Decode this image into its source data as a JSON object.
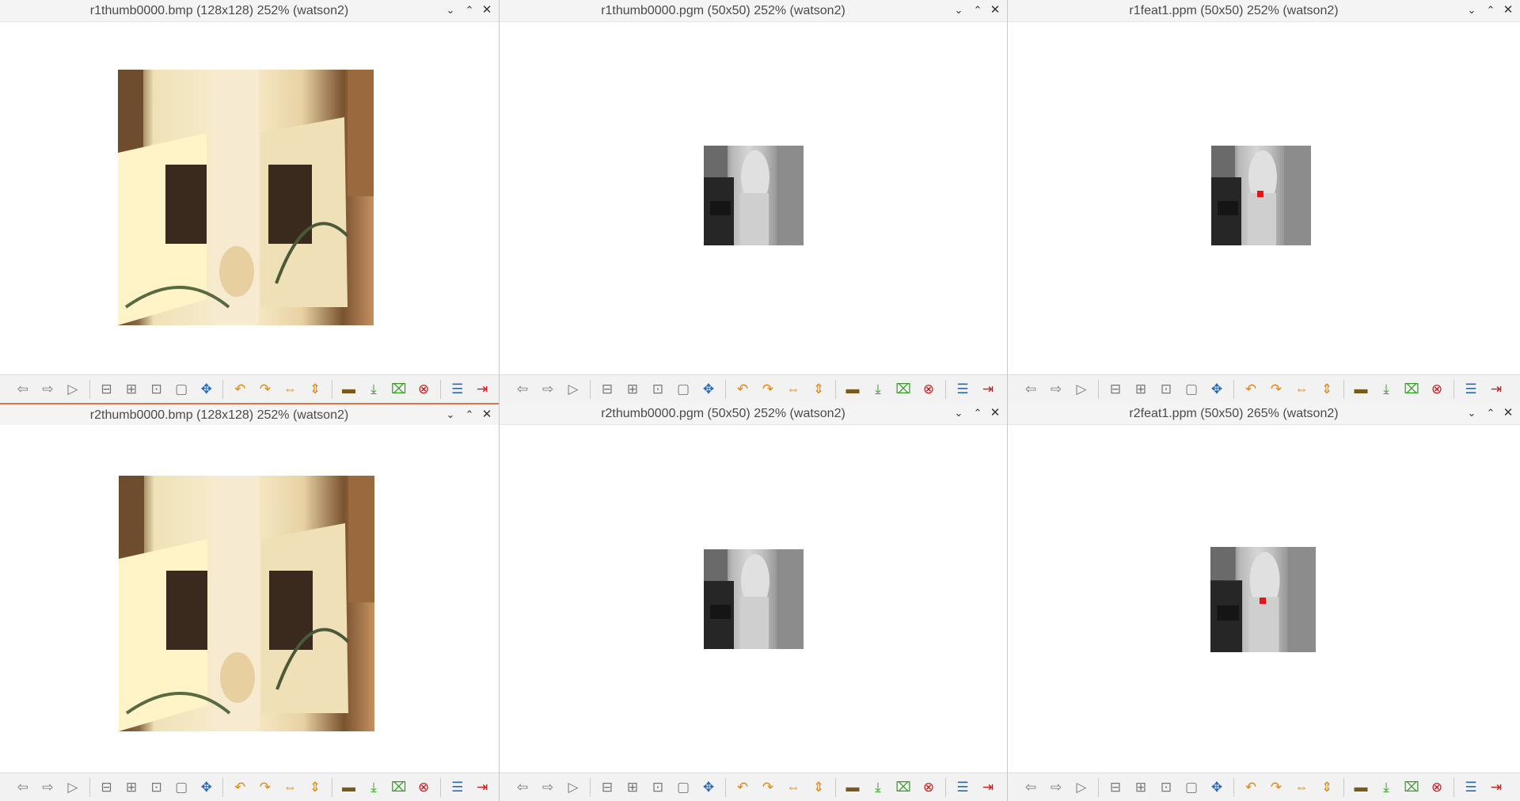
{
  "windows": [
    {
      "title": "r1thumb0000.bmp (128x128) 252% (watson2)",
      "image_kind": "color-thumbnail",
      "has_feature_marker": false
    },
    {
      "title": "r1thumb0000.pgm (50x50) 252% (watson2)",
      "image_kind": "gray-thumbnail",
      "has_feature_marker": false
    },
    {
      "title": "r1feat1.ppm (50x50) 252% (watson2)",
      "image_kind": "gray-thumbnail",
      "has_feature_marker": true,
      "marker_color": "#ee1111"
    },
    {
      "title": "r2thumb0000.bmp (128x128) 252% (watson2)",
      "image_kind": "color-thumbnail",
      "has_feature_marker": false
    },
    {
      "title": "r2thumb0000.pgm (50x50) 252% (watson2)",
      "image_kind": "gray-thumbnail",
      "has_feature_marker": false
    },
    {
      "title": "r2feat1.ppm (50x50) 265% (watson2)",
      "image_kind": "gray-thumbnail",
      "has_feature_marker": true,
      "marker_color": "#ee1111"
    }
  ],
  "titlebar_controls": {
    "minimize_glyph": "⌄",
    "maximize_glyph": "⌃",
    "close_glyph": "✕"
  },
  "toolbar": {
    "buttons": [
      {
        "icon": "prev-image-icon",
        "glyph": "⇦",
        "tint": "gray"
      },
      {
        "icon": "next-image-icon",
        "glyph": "⇨",
        "tint": "gray"
      },
      {
        "icon": "play-slideshow-icon",
        "glyph": "▷",
        "tint": "gray"
      },
      {
        "icon": "zoom-out-icon",
        "glyph": "⊟",
        "tint": "gray"
      },
      {
        "icon": "zoom-in-icon",
        "glyph": "⊞",
        "tint": "gray"
      },
      {
        "icon": "zoom-fit-icon",
        "glyph": "⊡",
        "tint": "gray"
      },
      {
        "icon": "zoom-original-icon",
        "glyph": "▢",
        "tint": "gray"
      },
      {
        "icon": "fullscreen-icon",
        "glyph": "✥",
        "tint": "blue"
      },
      {
        "icon": "rotate-left-icon",
        "glyph": "↶",
        "tint": "orange"
      },
      {
        "icon": "rotate-right-icon",
        "glyph": "↷",
        "tint": "orange"
      },
      {
        "icon": "flip-horizontal-icon",
        "glyph": "⇔",
        "tint": "orange"
      },
      {
        "icon": "flip-vertical-icon",
        "glyph": "⇕",
        "tint": "orange"
      },
      {
        "icon": "open-file-icon",
        "glyph": "▬",
        "tint": "brown"
      },
      {
        "icon": "save-file-icon",
        "glyph": "⤓",
        "tint": "green"
      },
      {
        "icon": "delete-file-icon",
        "glyph": "⌧",
        "tint": "green"
      },
      {
        "icon": "close-image-icon",
        "glyph": "⊗",
        "tint": "red"
      },
      {
        "icon": "properties-icon",
        "glyph": "☰",
        "tint": "blue"
      },
      {
        "icon": "quit-icon",
        "glyph": "⇥",
        "tint": "red"
      }
    ]
  }
}
